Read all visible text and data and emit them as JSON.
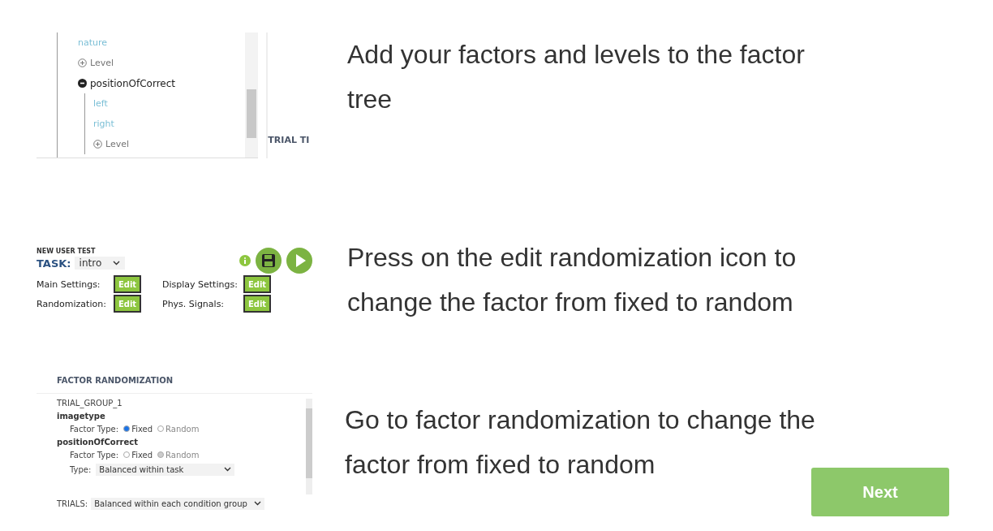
{
  "steps": [
    {
      "kind": "tree",
      "caption": "Add your factors and levels to the factor tree",
      "tree": [
        {
          "label": "nature",
          "kind": "level"
        },
        {
          "label": "Level",
          "kind": "add"
        },
        {
          "label": "positionOfCorrect",
          "kind": "factor",
          "expanded": true,
          "children": [
            {
              "label": "left",
              "kind": "level"
            },
            {
              "label": "right",
              "kind": "level"
            },
            {
              "label": "Level",
              "kind": "add"
            }
          ]
        }
      ],
      "side_label": "TRIAL TI"
    },
    {
      "kind": "settings",
      "caption": "Press on the edit randomization icon to change the factor from fixed to random",
      "title": "NEW USER TEST",
      "task_label": "TASK:",
      "task_value": "intro",
      "settings": [
        {
          "label": "Main Settings:",
          "button": "Edit"
        },
        {
          "label": "Display Settings:",
          "button": "Edit"
        },
        {
          "label": "Randomization:",
          "button": "Edit"
        },
        {
          "label": "Phys. Signals:",
          "button": "Edit"
        }
      ]
    },
    {
      "kind": "randomization",
      "caption": "Go to factor randomization to change the factor from fixed to random",
      "title": "FACTOR RANDOMIZATION",
      "group": "TRIAL_GROUP_1",
      "factors": [
        {
          "name": "imagetype",
          "type_label": "Factor Type:",
          "options": [
            {
              "label": "Fixed",
              "selected": true,
              "disabled": false
            },
            {
              "label": "Random",
              "selected": false,
              "disabled": true
            }
          ]
        },
        {
          "name": "positionOfCorrect",
          "type_label": "Factor Type:",
          "options": [
            {
              "label": "Fixed",
              "selected": false,
              "disabled": false
            },
            {
              "label": "Random",
              "selected": true,
              "disabled": true
            }
          ],
          "select_label": "Type:",
          "select_value": "Balanced within task"
        }
      ],
      "trials_label": "TRIALS:",
      "trials_value": "Balanced within each condition group"
    }
  ],
  "next_button": "Next"
}
